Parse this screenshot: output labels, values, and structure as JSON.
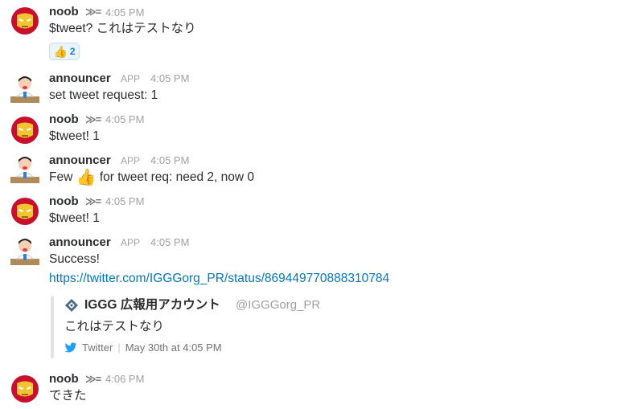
{
  "messages": [
    {
      "user": "noob",
      "time": "4:05 PM",
      "text": "$tweet? これはテストなり",
      "reaction": {
        "emoji": "thumbs-up",
        "count": "2"
      }
    },
    {
      "user": "announcer",
      "badge": "APP",
      "time": "4:05 PM",
      "text": "set tweet request: 1"
    },
    {
      "user": "noob",
      "time": "4:05 PM",
      "text": "$tweet! 1"
    },
    {
      "user": "announcer",
      "badge": "APP",
      "time": "4:05 PM",
      "text_before": "Few",
      "text_after": "for tweet req: need 2, now 0"
    },
    {
      "user": "noob",
      "time": "4:05 PM",
      "text": "$tweet! 1"
    },
    {
      "user": "announcer",
      "badge": "APP",
      "time": "4:05 PM",
      "text": "Success!",
      "link": "https://twitter.com/IGGGorg_PR/status/869449770888310784",
      "attachment": {
        "author": "IGGG 広報用アカウント",
        "handle": "@IGGGorg_PR",
        "body": "これはテストなり",
        "service": "Twitter",
        "date": "May 30th at 4:05 PM"
      }
    },
    {
      "user": "noob",
      "time": "4:06 PM",
      "text": "できた"
    }
  ],
  "colors": {
    "link": "#0576b9",
    "twitter": "#1da1f2",
    "ironman_red": "#c8102e",
    "ironman_gold": "#f4c430"
  }
}
